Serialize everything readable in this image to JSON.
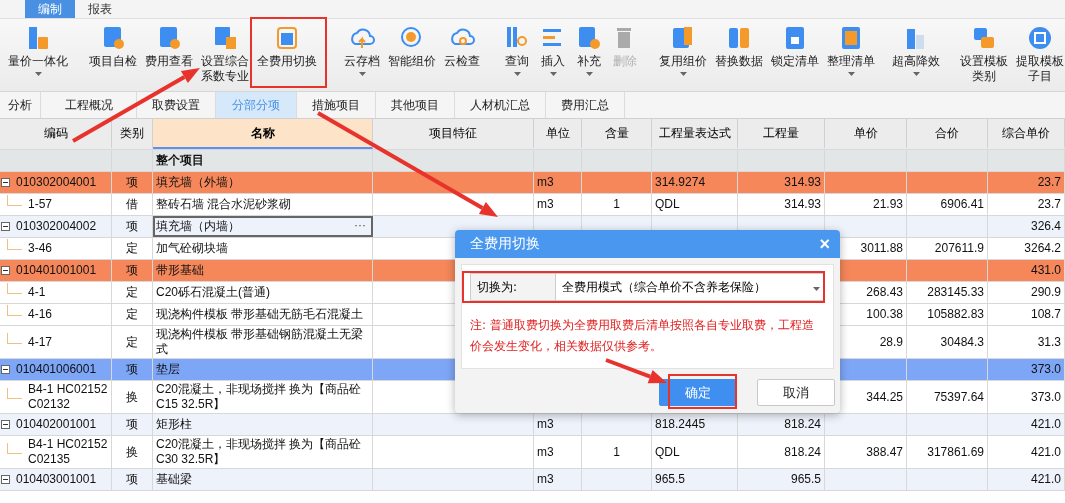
{
  "menu": {
    "tabs": [
      {
        "label": "编制",
        "selected": true
      },
      {
        "label": "报表",
        "selected": false
      }
    ]
  },
  "toolbar": {
    "groups": [
      [
        {
          "label": "量价一体化",
          "dropdown": true,
          "disabled": false
        }
      ],
      [
        {
          "label": "项目自检",
          "dropdown": false,
          "disabled": false
        },
        {
          "label": "费用查看",
          "dropdown": false,
          "disabled": false
        },
        {
          "label": "设置综合系数专业",
          "dropdown": false,
          "disabled": false
        },
        {
          "label": "全费用切换",
          "dropdown": false,
          "disabled": false
        }
      ],
      [
        {
          "label": "云存档",
          "dropdown": true,
          "disabled": false
        },
        {
          "label": "智能组价",
          "dropdown": false,
          "disabled": false
        },
        {
          "label": "云检查",
          "dropdown": false,
          "disabled": false
        }
      ],
      [
        {
          "label": "查询",
          "dropdown": true,
          "disabled": false
        },
        {
          "label": "插入",
          "dropdown": true,
          "disabled": false
        },
        {
          "label": "补充",
          "dropdown": true,
          "disabled": false
        },
        {
          "label": "删除",
          "dropdown": false,
          "disabled": true
        }
      ],
      [
        {
          "label": "复用组价",
          "dropdown": true,
          "disabled": false
        },
        {
          "label": "替换数据",
          "dropdown": false,
          "disabled": false
        },
        {
          "label": "锁定清单",
          "dropdown": false,
          "disabled": false
        },
        {
          "label": "整理清单",
          "dropdown": true,
          "disabled": false
        }
      ],
      [
        {
          "label": "超高降效",
          "dropdown": true,
          "disabled": false
        }
      ],
      [
        {
          "label": "设置模板类别",
          "dropdown": false,
          "disabled": false
        },
        {
          "label": "提取模板子目",
          "dropdown": false,
          "disabled": false
        }
      ]
    ]
  },
  "tabs": [
    {
      "label": "分析",
      "selected": false
    },
    {
      "label": "工程概况",
      "selected": false
    },
    {
      "label": "取费设置",
      "selected": false
    },
    {
      "label": "分部分项",
      "selected": true
    },
    {
      "label": "措施项目",
      "selected": false
    },
    {
      "label": "其他项目",
      "selected": false
    },
    {
      "label": "人材机汇总",
      "selected": false
    },
    {
      "label": "费用汇总",
      "selected": false
    }
  ],
  "table": {
    "columns": [
      {
        "label": "编码",
        "selected": false
      },
      {
        "label": "类别",
        "selected": false
      },
      {
        "label": "名称",
        "selected": true
      },
      {
        "label": "项目特征",
        "selected": false
      },
      {
        "label": "单位",
        "selected": false
      },
      {
        "label": "含量",
        "selected": false
      },
      {
        "label": "工程量表达式",
        "selected": false
      },
      {
        "label": "工程量",
        "selected": false
      },
      {
        "label": "单价",
        "selected": false
      },
      {
        "label": "合价",
        "selected": false
      },
      {
        "label": "综合单价",
        "selected": false
      }
    ],
    "edit_button": "···",
    "rows": [
      {
        "kind": "group",
        "name": "整个项目",
        "selected": false,
        "editing": false
      },
      {
        "kind": "item",
        "expanded": true,
        "color": "#f5875a",
        "code": "010302004001",
        "type": "项",
        "name": "填充墙（外墙）",
        "unit": "m3",
        "expr": "314.9274",
        "quantity": "314.93",
        "unit_total": "23.7",
        "selected": false,
        "editing": false
      },
      {
        "kind": "sub",
        "code": "1-57",
        "type": "借",
        "name": "整砖石墙 混合水泥砂浆砌",
        "unit": "m3",
        "content": "1",
        "expr": "QDL",
        "quantity": "314.93",
        "price": "21.93",
        "total": "6906.41",
        "unit_total": "23.7",
        "selected": false,
        "editing": false
      },
      {
        "kind": "item",
        "expanded": true,
        "color": "#eef3fb",
        "code": "010302004002",
        "type": "项",
        "name": "填充墙（内墙）",
        "unit_total": "326.4",
        "selected": false,
        "editing": true
      },
      {
        "kind": "sub",
        "code": "3-46",
        "type": "定",
        "name": "加气砼砌块墙",
        "price": "3011.88",
        "total": "207611.9",
        "unit_total": "3264.2",
        "selected": false,
        "editing": false
      },
      {
        "kind": "item",
        "expanded": true,
        "color": "#f5875a",
        "code": "010401001001",
        "type": "项",
        "name": "带形基础",
        "unit_total": "431.0",
        "selected": false,
        "editing": false
      },
      {
        "kind": "sub",
        "code": "4-1",
        "type": "定",
        "name": "C20砾石混凝土(普通)",
        "price": "268.43",
        "total": "283145.33",
        "unit_total": "290.9",
        "selected": false,
        "editing": false
      },
      {
        "kind": "sub",
        "code": "4-16",
        "type": "定",
        "name": "现浇构件模板 带形基础无筋毛石混凝土",
        "price": "100.38",
        "total": "105882.83",
        "unit_total": "108.7",
        "selected": false,
        "editing": false
      },
      {
        "kind": "sub",
        "code": "4-17",
        "type": "定",
        "name": "现浇构件模板 带形基础钢筋混凝土无梁式",
        "price": "28.9",
        "total": "30484.3",
        "unit_total": "31.3",
        "selected": false,
        "editing": false
      },
      {
        "kind": "item",
        "expanded": true,
        "code": "010401006001",
        "type": "项",
        "name": "垫层",
        "unit_total": "373.0",
        "selected": true,
        "editing": false
      },
      {
        "kind": "sub",
        "code": "B4-1 HC02152 C02132",
        "type": "换",
        "name": "C20混凝土，非现场搅拌 换为【商品砼 C15 32.5R】",
        "price": "344.25",
        "total": "75397.64",
        "unit_total": "373.0",
        "selected": false,
        "editing": false
      },
      {
        "kind": "item",
        "expanded": true,
        "color": "#eef3fb",
        "code": "010402001001",
        "type": "项",
        "name": "矩形柱",
        "unit": "m3",
        "expr": "818.2445",
        "quantity": "818.24",
        "unit_total": "421.0",
        "selected": false,
        "editing": false
      },
      {
        "kind": "sub",
        "code": "B4-1 HC02152 C02135",
        "type": "换",
        "name": "C20混凝土，非现场搅拌 换为【商品砼 C30 32.5R】",
        "unit": "m3",
        "content": "1",
        "expr": "QDL",
        "quantity": "818.24",
        "price": "388.47",
        "total": "317861.69",
        "unit_total": "421.0",
        "selected": false,
        "editing": false
      },
      {
        "kind": "item",
        "expanded": true,
        "color": "#eef3fb",
        "code": "010403001001",
        "type": "项",
        "name": "基础梁",
        "unit": "m3",
        "expr": "965.5",
        "quantity": "965.5",
        "unit_total": "421.0",
        "selected": false,
        "editing": false
      }
    ]
  },
  "dialog": {
    "title": "全费用切换",
    "close": "×",
    "field_label": "切换为:",
    "value": "全费用模式（综合单价不含养老保险）",
    "note": "注: 普通取费切换为全费用取费后清单按照各自专业取费，工程造价会发生变化，相关数据仅供参考。",
    "buttons": [
      {
        "label": "确定",
        "kind": "primary"
      },
      {
        "label": "取消",
        "kind": "secondary"
      }
    ]
  }
}
